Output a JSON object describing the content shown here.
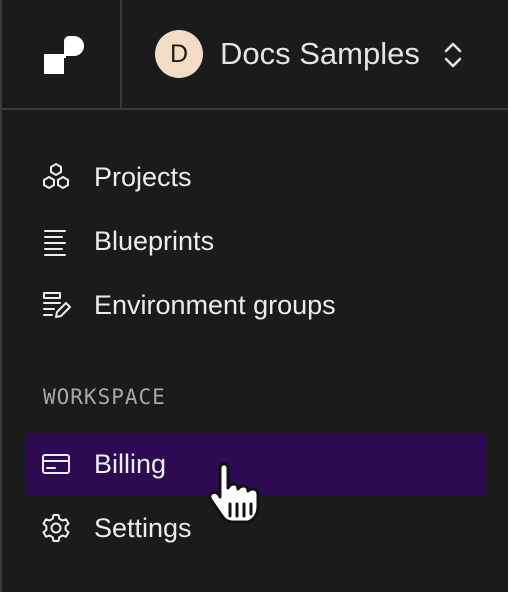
{
  "workspace": {
    "avatar_initial": "D",
    "name": "Docs Samples"
  },
  "nav": {
    "items": [
      {
        "label": "Projects",
        "icon": "projects-icon"
      },
      {
        "label": "Blueprints",
        "icon": "blueprints-icon"
      },
      {
        "label": "Environment groups",
        "icon": "environment-groups-icon"
      }
    ]
  },
  "workspace_section": {
    "heading": "WORKSPACE",
    "items": [
      {
        "label": "Billing",
        "icon": "credit-card-icon",
        "active": true
      },
      {
        "label": "Settings",
        "icon": "gear-icon",
        "active": false
      }
    ]
  },
  "colors": {
    "background": "#1b1b1b",
    "border": "#3a3a3a",
    "active_item": "#2c0b52",
    "avatar": "#f3dcc6",
    "text": "#ececec",
    "muted_text": "#a8a8a8"
  }
}
